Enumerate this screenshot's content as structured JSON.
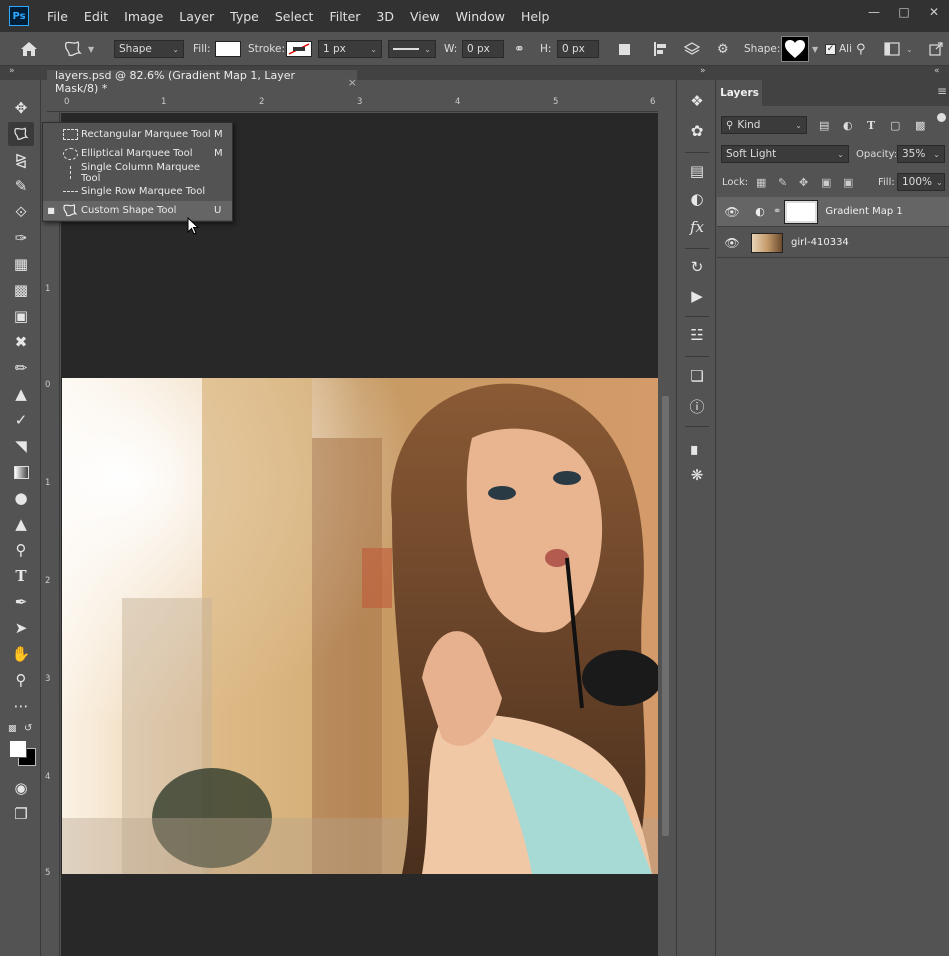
{
  "menubar": {
    "logo": "Ps",
    "items": [
      "File",
      "Edit",
      "Image",
      "Layer",
      "Type",
      "Select",
      "Filter",
      "3D",
      "View",
      "Window",
      "Help"
    ],
    "controls": [
      "—",
      "□",
      "✕"
    ]
  },
  "options": {
    "mode": "Shape",
    "fill_label": "Fill:",
    "stroke_label": "Stroke:",
    "stroke_width": "1 px",
    "w_label": "W:",
    "w_value": "0 px",
    "h_label": "H:",
    "h_value": "0 px",
    "shape_label": "Shape:",
    "align_label": "Ali"
  },
  "document": {
    "tab_title": "layers.psd @ 82.6% (Gradient Map 1, Layer Mask/8) *",
    "close_glyph": "×",
    "ruler_top": [
      "0",
      "1",
      "2",
      "3",
      "4",
      "5",
      "6"
    ],
    "ruler_left": [
      "1",
      "0",
      "1",
      "2",
      "3",
      "4",
      "5"
    ]
  },
  "flyout": {
    "items": [
      {
        "label": "Rectangular Marquee Tool",
        "key": "M",
        "active": false,
        "icon": "rect-marquee-icon"
      },
      {
        "label": "Elliptical Marquee Tool",
        "key": "M",
        "active": false,
        "icon": "ellipse-marquee-icon"
      },
      {
        "label": "Single Column Marquee Tool",
        "key": "",
        "active": false,
        "icon": "single-column-icon"
      },
      {
        "label": "Single Row Marquee Tool",
        "key": "",
        "active": false,
        "icon": "single-row-icon"
      },
      {
        "label": "Custom Shape Tool",
        "key": "U",
        "active": true,
        "icon": "custom-shape-icon"
      }
    ],
    "bullet": "■"
  },
  "layers": {
    "tab": "Layers",
    "filter_kind": "Kind",
    "blend_mode": "Soft Light",
    "opacity_label": "Opacity:",
    "opacity_value": "35%",
    "lock_label": "Lock:",
    "fill_label": "Fill:",
    "fill_value": "100%",
    "rows": [
      {
        "name": "Gradient Map 1",
        "selected": true
      },
      {
        "name": "girl-410334",
        "selected": false
      }
    ]
  },
  "colors": {
    "accent": "#31a8ff",
    "panel": "#535353",
    "menubar": "#323232",
    "canvas_bg": "#282828"
  }
}
